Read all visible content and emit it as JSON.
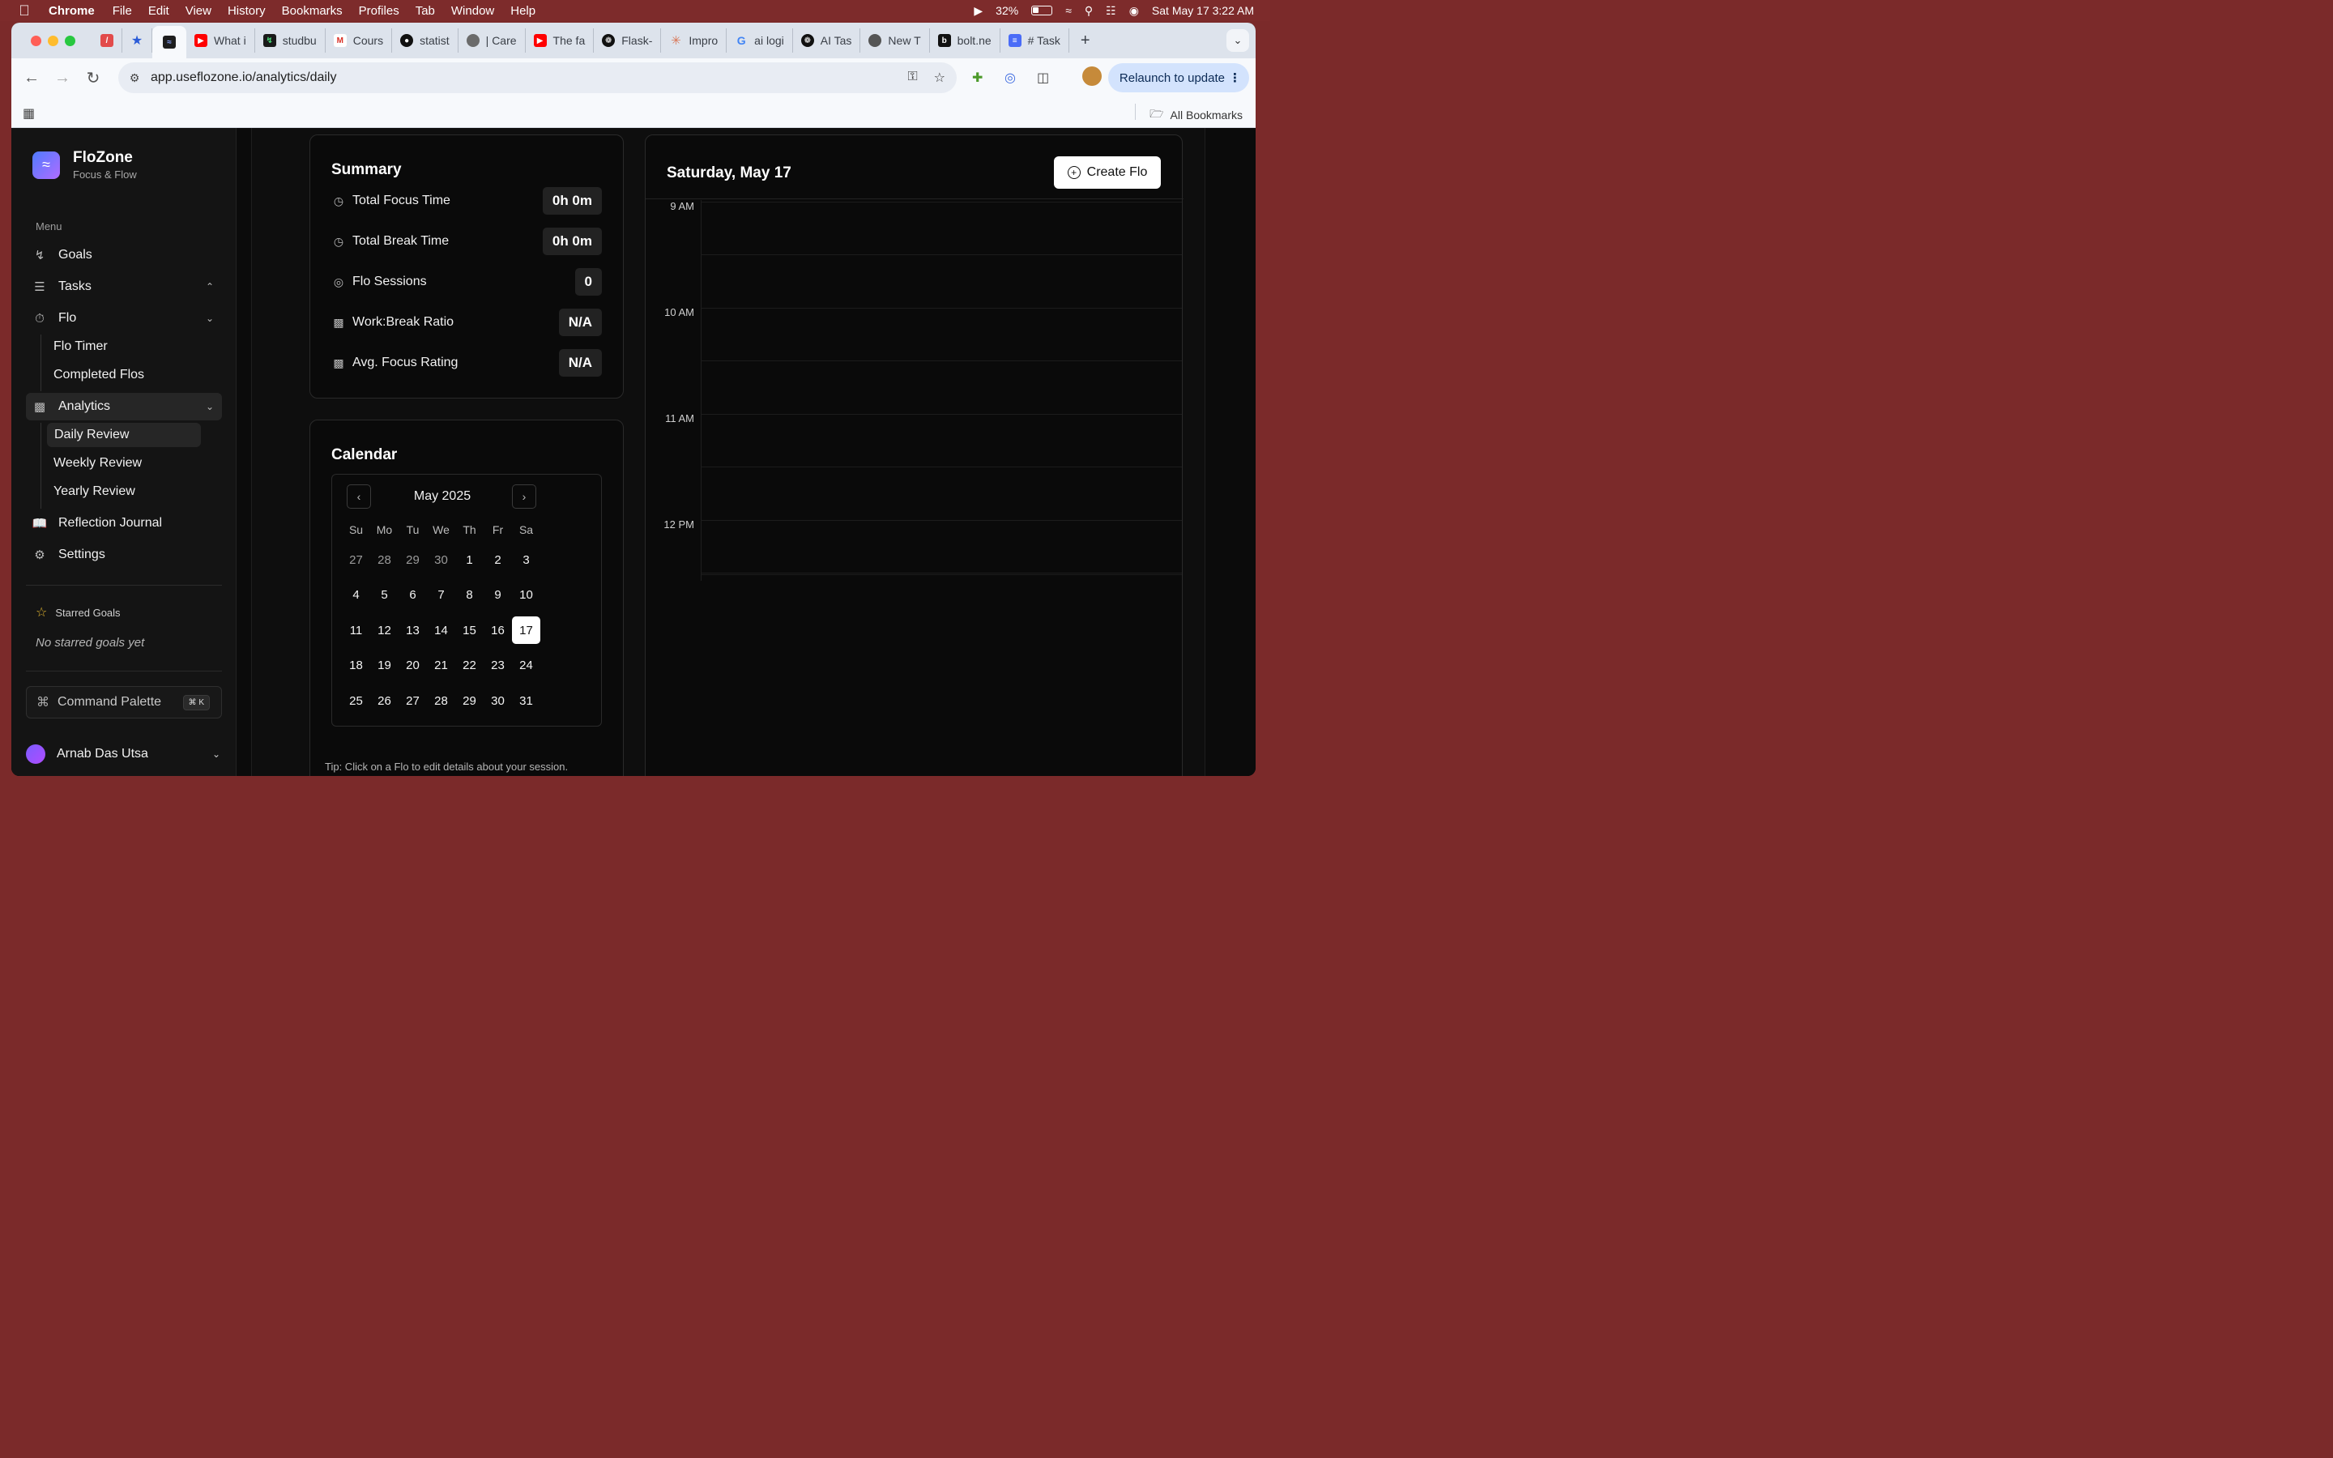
{
  "os_menubar": {
    "app": "Chrome",
    "menus": [
      "File",
      "Edit",
      "View",
      "History",
      "Bookmarks",
      "Profiles",
      "Tab",
      "Window",
      "Help"
    ],
    "battery": "32%",
    "datetime": "Sat May 17  3:22 AM"
  },
  "browser": {
    "tabs": [
      {
        "label": "",
        "icon": "slash-app-icon",
        "color": "#e24b4b"
      },
      {
        "label": "",
        "icon": "star-app-icon",
        "color": "#2a5bd7"
      },
      {
        "label": "",
        "icon": "flozone-icon",
        "color": "#1e1e1e"
      },
      {
        "label": "What i",
        "icon": "youtube-icon",
        "color": "#ff0000"
      },
      {
        "label": "studbu",
        "icon": "bolt-app-icon",
        "color": "#1a1a1a"
      },
      {
        "label": "Cours",
        "icon": "gmail-icon",
        "color": "#d93025"
      },
      {
        "label": "statist",
        "icon": "github-icon",
        "color": "#111111"
      },
      {
        "label": "| Care",
        "icon": "globe-icon",
        "color": "#6b6b6b"
      },
      {
        "label": "The fa",
        "icon": "youtube-icon",
        "color": "#ff0000"
      },
      {
        "label": "Flask-",
        "icon": "openai-icon",
        "color": "#111111"
      },
      {
        "label": "Impro",
        "icon": "claude-icon",
        "color": "#d97757"
      },
      {
        "label": "ai logi",
        "icon": "google-icon",
        "color": "#4285f4"
      },
      {
        "label": "AI Tas",
        "icon": "openai-icon",
        "color": "#111111"
      },
      {
        "label": "New T",
        "icon": "chrome-icon",
        "color": "#555555"
      },
      {
        "label": "bolt.ne",
        "icon": "bolt-b-icon",
        "color": "#111111"
      },
      {
        "label": "# Task",
        "icon": "docs-icon",
        "color": "#4a6cf7"
      }
    ],
    "url": "app.useflozone.io/analytics/daily",
    "relaunch": "Relaunch to update",
    "all_bookmarks": "All Bookmarks"
  },
  "sidebar": {
    "brand_name": "FloZone",
    "brand_sub": "Focus & Flow",
    "menu_label": "Menu",
    "items": {
      "goals": "Goals",
      "tasks": "Tasks",
      "flo": "Flo",
      "flo_timer": "Flo Timer",
      "completed_flos": "Completed Flos",
      "analytics": "Analytics",
      "daily_review": "Daily Review",
      "weekly_review": "Weekly Review",
      "yearly_review": "Yearly Review",
      "reflection_journal": "Reflection Journal",
      "settings": "Settings"
    },
    "starred_label": "Starred Goals",
    "no_starred": "No starred goals yet",
    "command_palette": "Command Palette",
    "command_kbd": "⌘ K",
    "user_name": "Arnab Das Utsa"
  },
  "summary": {
    "title": "Summary",
    "rows": [
      {
        "label": "Total Focus Time",
        "value": "0h 0m"
      },
      {
        "label": "Total Break Time",
        "value": "0h 0m"
      },
      {
        "label": "Flo Sessions",
        "value": "0"
      },
      {
        "label": "Work:Break Ratio",
        "value": "N/A"
      },
      {
        "label": "Avg. Focus Rating",
        "value": "N/A"
      }
    ]
  },
  "calendar": {
    "title": "Calendar",
    "month": "May 2025",
    "weekdays": [
      "Su",
      "Mo",
      "Tu",
      "We",
      "Th",
      "Fr",
      "Sa"
    ],
    "weeks": [
      [
        "27",
        "28",
        "29",
        "30",
        "1",
        "2",
        "3"
      ],
      [
        "4",
        "5",
        "6",
        "7",
        "8",
        "9",
        "10"
      ],
      [
        "11",
        "12",
        "13",
        "14",
        "15",
        "16",
        "17"
      ],
      [
        "18",
        "19",
        "20",
        "21",
        "22",
        "23",
        "24"
      ],
      [
        "25",
        "26",
        "27",
        "28",
        "29",
        "30",
        "31"
      ]
    ],
    "selected": "17",
    "tip": "Tip: Click on a Flo to edit details about your session."
  },
  "schedule": {
    "title": "Saturday, May 17",
    "create_label": "Create Flo",
    "hours": [
      "9 AM",
      "10 AM",
      "11 AM",
      "12 PM"
    ]
  }
}
